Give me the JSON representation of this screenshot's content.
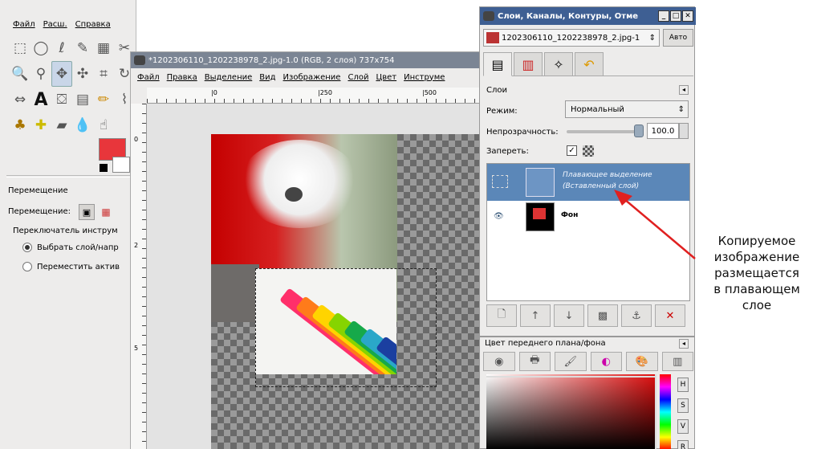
{
  "toolbox": {
    "menu": [
      "Файл",
      "Расш.",
      "Справка"
    ],
    "options_title": "Перемещение",
    "move_label": "Перемещение:",
    "switch_label": "Переключатель инструм",
    "radio1": "Выбрать слой/напр",
    "radio2": "Переместить актив"
  },
  "image_window": {
    "title": "*1202306110_1202238978_2.jpg-1.0 (RGB, 2 слоя) 737x754",
    "menu": [
      "Файл",
      "Правка",
      "Выделение",
      "Вид",
      "Изображение",
      "Слой",
      "Цвет",
      "Инструме"
    ],
    "ruler_top": [
      "|0",
      "|250",
      "|500"
    ],
    "ruler_left": [
      "0",
      "2",
      "5"
    ]
  },
  "layers_dock": {
    "title": "Слои, Каналы, Контуры, Отме",
    "image_name": "1202306110_1202238978_2.jpg-1",
    "auto_button": "Авто",
    "layers_label": "Слои",
    "mode_label": "Режим:",
    "mode_value": "Нормальный",
    "opacity_label": "Непрозрачность:",
    "opacity_value": "100.0",
    "opacity_fraction": 1.0,
    "lock_label": "Запереть:",
    "layers": [
      {
        "name": "Плавающее выделение",
        "sub": "(Вставленный слой)"
      },
      {
        "name": "Фон"
      }
    ]
  },
  "color_dock": {
    "title": "Цвет переднего плана/фона",
    "hsv": [
      "H",
      "S",
      "V",
      "R"
    ],
    "fg_color": "#e8363b"
  },
  "annotation": {
    "text": [
      "Копируемое",
      "изображение",
      "размещается",
      "в плавающем",
      "слое"
    ],
    "arrow_color": "#e02020"
  }
}
